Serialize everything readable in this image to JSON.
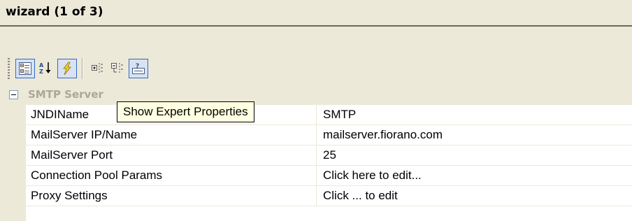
{
  "panel": {
    "title": "wizard (1 of 3)"
  },
  "toolbar": {
    "buttons": [
      {
        "icon": "categorized-view-icon",
        "pressed": true
      },
      {
        "icon": "sort-alphabetical-icon",
        "pressed": false
      },
      {
        "icon": "show-expert-properties-icon",
        "pressed": true
      },
      {
        "icon": "expand-all-icon",
        "pressed": false
      },
      {
        "icon": "collapse-all-icon",
        "pressed": false
      },
      {
        "icon": "property-help-icon",
        "pressed": true
      }
    ]
  },
  "tooltip": {
    "text": "Show Expert Properties"
  },
  "property_grid": {
    "category": {
      "label": "SMTP Server",
      "expanded": true
    },
    "rows": [
      {
        "name": "JNDIName",
        "value": "SMTP"
      },
      {
        "name": "MailServer IP/Name",
        "value": "mailserver.fiorano.com"
      },
      {
        "name": "MailServer Port",
        "value": "25"
      },
      {
        "name": "Connection Pool Params",
        "value": "Click here to edit..."
      },
      {
        "name": "Proxy Settings",
        "value": "Click ... to edit"
      }
    ]
  },
  "colors": {
    "chrome": "#ece9d8",
    "selection_border": "#316ac5",
    "tooltip_background": "#ffffe1",
    "category_text": "#aca899"
  }
}
